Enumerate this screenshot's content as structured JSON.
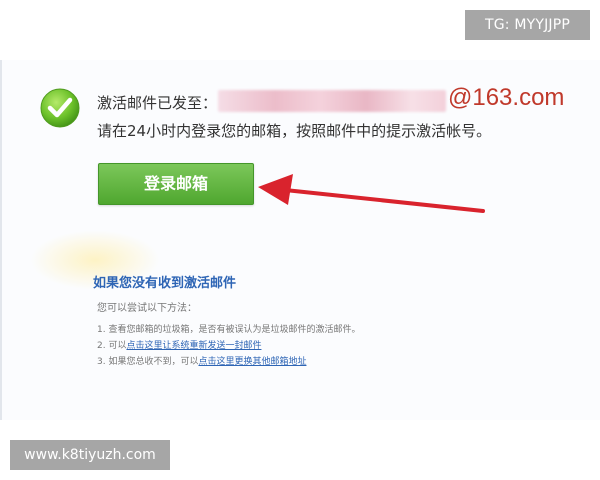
{
  "tg_badge": "TG: MYYJJPP",
  "activation": {
    "sent_label": "激活邮件已发至：",
    "email_domain": "@163.com",
    "instruction": "请在24小时内登录您的邮箱，按照邮件中的提示激活帐号。",
    "login_button": "登录邮箱"
  },
  "help": {
    "title": "如果您没有收到激活邮件",
    "intro": "您可以尝试以下方法：",
    "steps": [
      {
        "prefix": "1. 查看您邮箱的垃圾箱，是否有被误认为是垃圾邮件的激活邮件。",
        "link": "",
        "suffix": ""
      },
      {
        "prefix": "2. 可以",
        "link": "点击这里让系统重新发送一封邮件",
        "suffix": ""
      },
      {
        "prefix": "3. 如果您总收不到，可以",
        "link": "点击这里更换其他邮箱地址",
        "suffix": ""
      }
    ]
  },
  "watermark": "www.k8tiyuzh.com",
  "colors": {
    "button_green": "#5cb53a",
    "arrow_red": "#d9232d",
    "link_blue": "#2e65b5"
  }
}
